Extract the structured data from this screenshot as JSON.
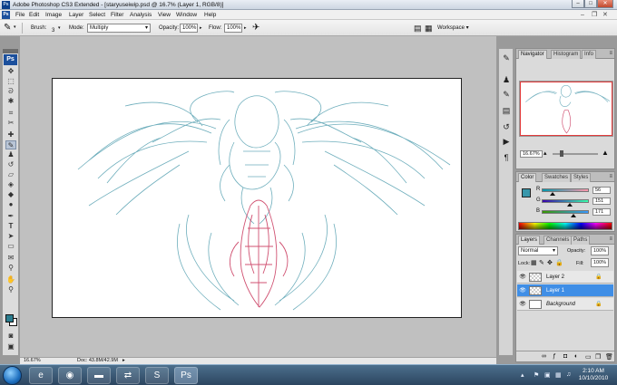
{
  "app": {
    "title": "Adobe Photoshop CS3 Extended - [staryuseiwip.psd @ 16.7% (Layer 1, RGB/8)]",
    "logo_text": "Ps"
  },
  "window_controls": {
    "minimize": "–",
    "maximize": "□",
    "close": "✕"
  },
  "menu": {
    "items": [
      "File",
      "Edit",
      "Image",
      "Layer",
      "Select",
      "Filter",
      "Analysis",
      "View",
      "Window",
      "Help"
    ]
  },
  "options": {
    "brush_label": "Brush:",
    "brush_size": "3",
    "mode_label": "Mode:",
    "mode_value": "Multiply",
    "opacity_label": "Opacity:",
    "opacity_value": "100%",
    "flow_label": "Flow:",
    "flow_value": "100%",
    "workspace_label": "Workspace ▾"
  },
  "tools": [
    "move",
    "marquee",
    "lasso",
    "quick-select",
    "crop",
    "slice",
    "healing",
    "brush",
    "clone-stamp",
    "history-brush",
    "eraser",
    "paint-bucket",
    "blur",
    "dodge",
    "pen",
    "type",
    "path-select",
    "shape",
    "notes",
    "eyedropper",
    "hand",
    "zoom"
  ],
  "status": {
    "zoom": "16.67%",
    "doc": "Doc: 43.8M/42.9M"
  },
  "navigator": {
    "tabs": [
      "Navigator",
      "Histogram",
      "Info"
    ],
    "zoom": "16.67%"
  },
  "color_panel": {
    "tabs": [
      "Color",
      "Swatches",
      "Styles"
    ],
    "r_label": "R",
    "r_value": "56",
    "g_label": "G",
    "g_value": "151",
    "b_label": "B",
    "b_value": "171",
    "r_level": 0.22,
    "g_level": 0.59,
    "b_level": 0.67,
    "fg_color": "#3897ab"
  },
  "layers_panel": {
    "tabs": [
      "Layers",
      "Channels",
      "Paths"
    ],
    "blend_mode": "Normal",
    "opacity_label": "Opacity:",
    "opacity_value": "100%",
    "lock_label": "Lock:",
    "fill_label": "Fill:",
    "fill_value": "100%",
    "layers": [
      {
        "name": "Layer 2",
        "selected": false
      },
      {
        "name": "Layer 1",
        "selected": true
      },
      {
        "name": "Background",
        "selected": false
      }
    ]
  },
  "taskbar": {
    "time": "2:10 AM",
    "date": "10/10/2010",
    "apps": [
      "ie-icon",
      "chrome-icon",
      "folder-icon",
      "network-icon",
      "skype-icon",
      "photoshop-icon"
    ]
  },
  "colors": {
    "sketch_blue": "#3e93a6",
    "sketch_red": "#c8345a",
    "accent": "#3f8ee6"
  }
}
